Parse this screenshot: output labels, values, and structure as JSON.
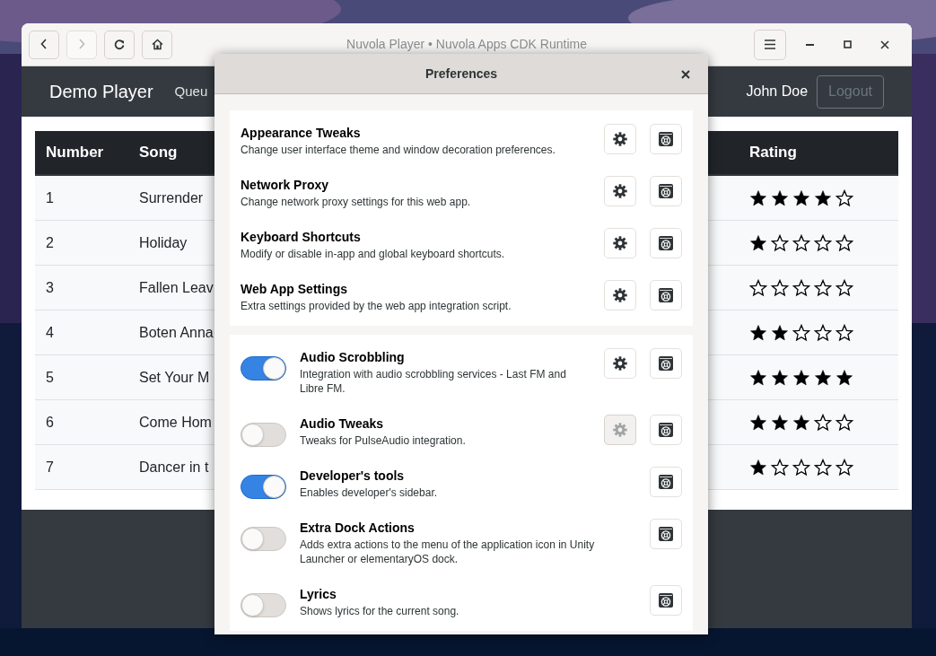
{
  "window": {
    "title": "Nuvola Player • Nuvola Apps CDK Runtime",
    "nav_buttons": [
      {
        "kind": "back",
        "disabled": false
      },
      {
        "kind": "forward",
        "disabled": true
      },
      {
        "kind": "reload",
        "disabled": false
      },
      {
        "kind": "home",
        "disabled": false
      }
    ]
  },
  "navbar": {
    "brand": "Demo Player",
    "links": [
      "Queu"
    ],
    "user": "John Doe",
    "logout": "Logout"
  },
  "table": {
    "columns": [
      "Number",
      "Song",
      "Rating"
    ],
    "rows": [
      {
        "number": "1",
        "song": "Surrender",
        "stars": 4
      },
      {
        "number": "2",
        "song": "Holiday",
        "stars": 1
      },
      {
        "number": "3",
        "song": "Fallen Leav",
        "stars": 0
      },
      {
        "number": "4",
        "song": "Boten Anna",
        "stars": 2
      },
      {
        "number": "5",
        "song": "Set Your M",
        "stars": 5
      },
      {
        "number": "6",
        "song": "Come Hom",
        "stars": 3
      },
      {
        "number": "7",
        "song": "Dancer in t",
        "stars": 1
      }
    ]
  },
  "dialog": {
    "title": "Preferences",
    "sections": [
      {
        "kind": "plain",
        "items": [
          {
            "title": "Appearance Tweaks",
            "description": "Change user interface theme and window decoration preferences.",
            "settings_button": {
              "disabled": false
            }
          },
          {
            "title": "Network Proxy",
            "description": "Change network proxy settings for this web app.",
            "settings_button": {
              "disabled": false
            }
          },
          {
            "title": "Keyboard Shortcuts",
            "description": "Modify or disable in-app and global keyboard shortcuts.",
            "settings_button": {
              "disabled": false
            }
          },
          {
            "title": "Web App Settings",
            "description": "Extra settings provided by the web app integration script.",
            "settings_button": {
              "disabled": false
            }
          }
        ]
      },
      {
        "kind": "toggles",
        "items": [
          {
            "title": "Audio Scrobbling",
            "description": "Integration with audio scrobbling services - Last FM and Libre FM.",
            "on": true,
            "settings_button": {
              "disabled": false
            }
          },
          {
            "title": "Audio Tweaks",
            "description": "Tweaks for PulseAudio integration.",
            "on": false,
            "settings_button": {
              "disabled": true
            }
          },
          {
            "title": "Developer's tools",
            "description": "Enables developer's sidebar.",
            "on": true
          },
          {
            "title": "Extra Dock Actions",
            "description": "Adds extra actions to the menu of the application icon in Unity Launcher or elementaryOS dock.",
            "on": false
          },
          {
            "title": "Lyrics",
            "description": "Shows lyrics for the current song.",
            "on": false
          }
        ]
      }
    ]
  }
}
